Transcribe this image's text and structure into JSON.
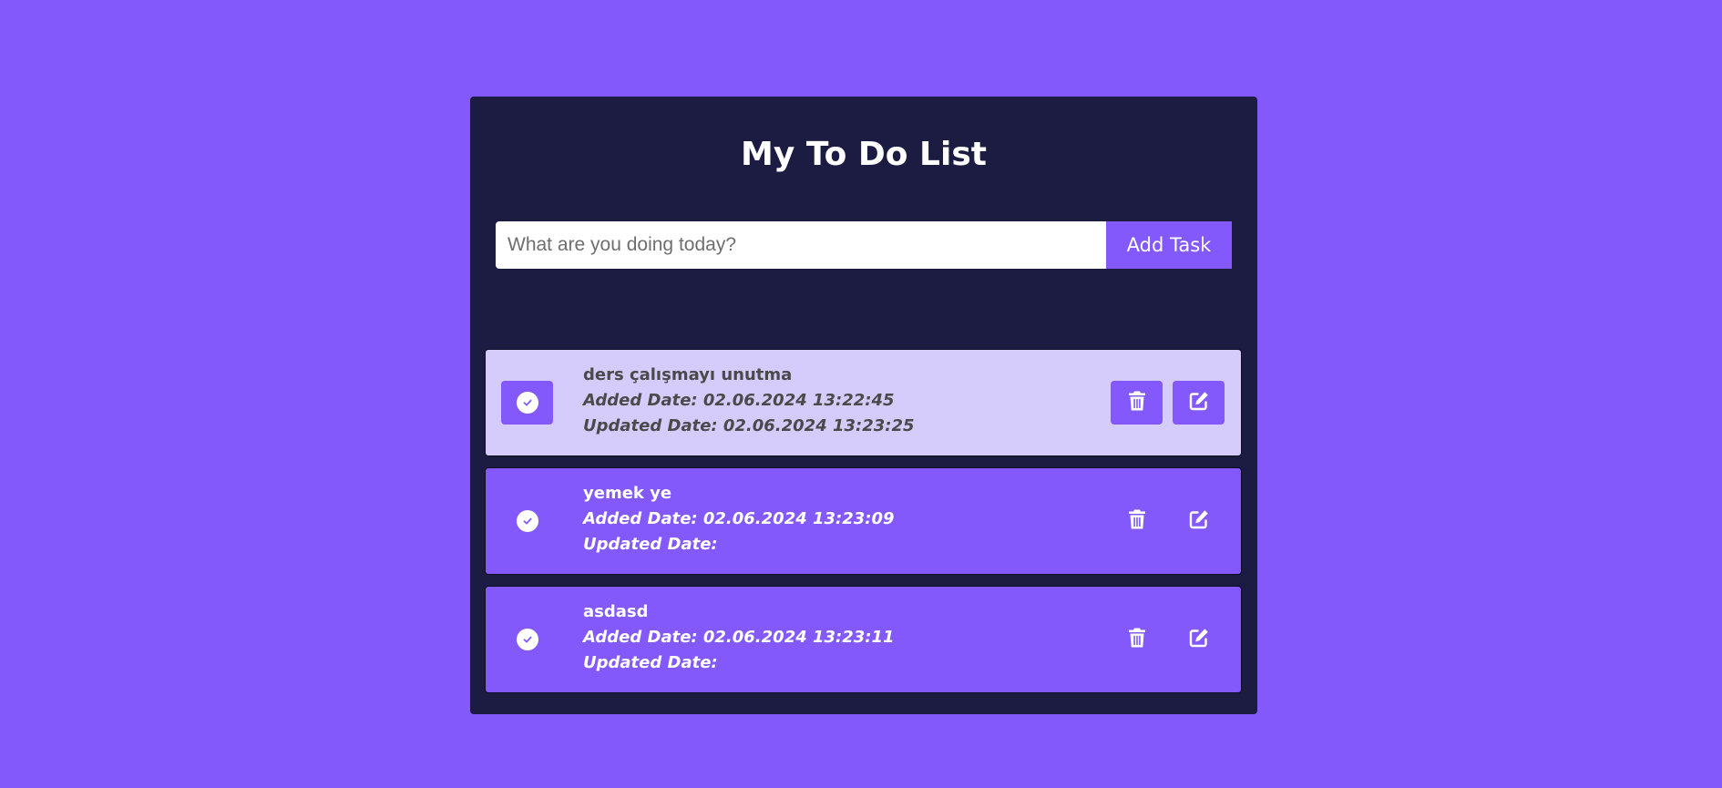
{
  "app": {
    "title": "My To Do List"
  },
  "add_task": {
    "input_value": "",
    "placeholder": "What are you doing today?",
    "button_label": "Add Task"
  },
  "colors": {
    "background": "#8359fb",
    "panel": "#1c1b42",
    "task_active": "#8359fb",
    "task_completed": "#d6ccfb"
  },
  "icons": {
    "check": "check-circle-icon",
    "delete": "trash-icon",
    "edit": "pencil-square-icon"
  },
  "tasks": [
    {
      "name": "ders çalışmayı unutma",
      "added": "Added Date: 02.06.2024 13:22:45",
      "updated": "Updated Date: 02.06.2024 13:23:25",
      "completed": true
    },
    {
      "name": "yemek ye",
      "added": "Added Date: 02.06.2024 13:23:09",
      "updated": "Updated Date:",
      "completed": false
    },
    {
      "name": "asdasd",
      "added": "Added Date: 02.06.2024 13:23:11",
      "updated": "Updated Date:",
      "completed": false
    }
  ]
}
